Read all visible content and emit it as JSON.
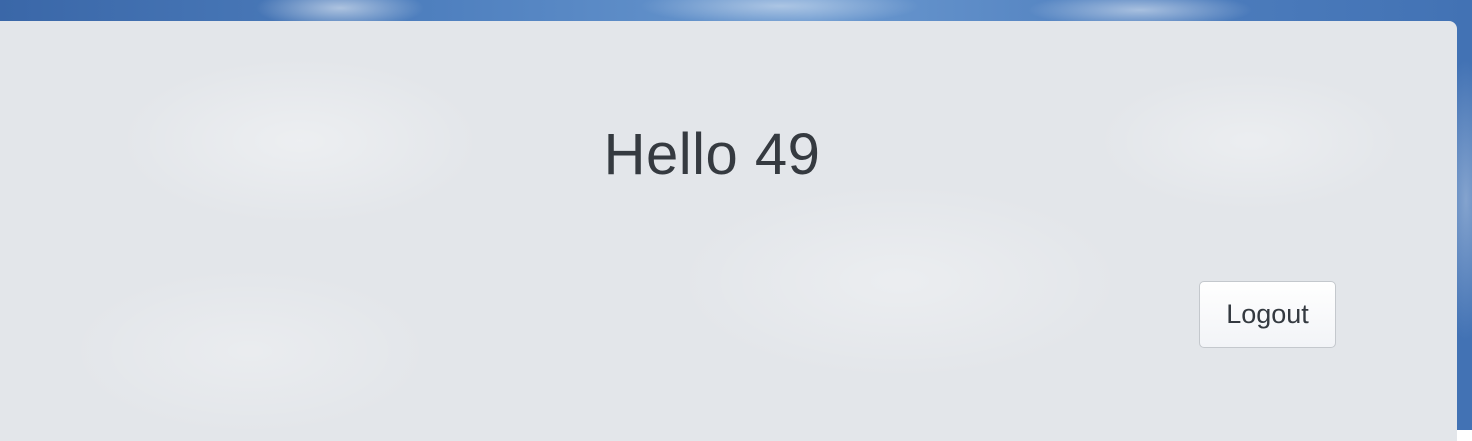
{
  "main": {
    "greeting": "Hello 49",
    "logout_label": "Logout"
  },
  "colors": {
    "panel_background": "#e3e6ea",
    "greeting_text": "#353a40",
    "button_border": "#c4c8cd",
    "sky_blue": "#4f80bf"
  }
}
